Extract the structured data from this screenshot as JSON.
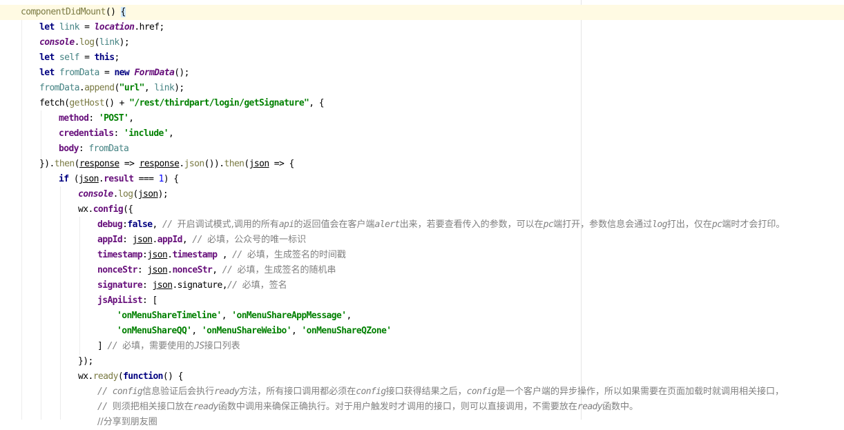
{
  "editor": {
    "lines": [
      {
        "indent": 30,
        "current": true,
        "tokens": [
          {
            "t": "componentDidMount",
            "c": "method"
          },
          {
            "t": "() ",
            "c": ""
          },
          {
            "t": "{",
            "c": "brace-hl"
          }
        ]
      },
      {
        "indent": 57,
        "tokens": [
          {
            "t": "let ",
            "c": "kw"
          },
          {
            "t": "link",
            "c": "local"
          },
          {
            "t": " = ",
            "c": ""
          },
          {
            "t": "location",
            "c": "glob"
          },
          {
            "t": ".href;",
            "c": ""
          }
        ]
      },
      {
        "indent": 57,
        "tokens": [
          {
            "t": "console",
            "c": "glob"
          },
          {
            "t": ".",
            "c": ""
          },
          {
            "t": "log",
            "c": "method"
          },
          {
            "t": "(",
            "c": ""
          },
          {
            "t": "link",
            "c": "local"
          },
          {
            "t": ");",
            "c": ""
          }
        ]
      },
      {
        "indent": 57,
        "tokens": [
          {
            "t": "let ",
            "c": "kw"
          },
          {
            "t": "self",
            "c": "local"
          },
          {
            "t": " = ",
            "c": ""
          },
          {
            "t": "this",
            "c": "kw"
          },
          {
            "t": ";",
            "c": ""
          }
        ]
      },
      {
        "indent": 57,
        "tokens": [
          {
            "t": "let ",
            "c": "kw"
          },
          {
            "t": "fromData",
            "c": "local"
          },
          {
            "t": " = ",
            "c": ""
          },
          {
            "t": "new ",
            "c": "kw"
          },
          {
            "t": "FormData",
            "c": "glob"
          },
          {
            "t": "();",
            "c": ""
          }
        ]
      },
      {
        "indent": 57,
        "tokens": [
          {
            "t": "fromData",
            "c": "local"
          },
          {
            "t": ".",
            "c": ""
          },
          {
            "t": "append",
            "c": "method"
          },
          {
            "t": "(",
            "c": ""
          },
          {
            "t": "\"url\"",
            "c": "str"
          },
          {
            "t": ", ",
            "c": ""
          },
          {
            "t": "link",
            "c": "local"
          },
          {
            "t": ");",
            "c": ""
          }
        ]
      },
      {
        "indent": 57,
        "tokens": [
          {
            "t": "fetch",
            "c": "fn"
          },
          {
            "t": "(",
            "c": ""
          },
          {
            "t": "getHost",
            "c": "method"
          },
          {
            "t": "() + ",
            "c": ""
          },
          {
            "t": "\"/rest/thirdpart/login/getSignature\"",
            "c": "str"
          },
          {
            "t": ", {",
            "c": ""
          }
        ]
      },
      {
        "indent": 85,
        "tokens": [
          {
            "t": "method",
            "c": "prop"
          },
          {
            "t": ": ",
            "c": ""
          },
          {
            "t": "'POST'",
            "c": "str"
          },
          {
            "t": ",",
            "c": ""
          }
        ]
      },
      {
        "indent": 85,
        "tokens": [
          {
            "t": "credentials",
            "c": "prop"
          },
          {
            "t": ": ",
            "c": ""
          },
          {
            "t": "'include'",
            "c": "str"
          },
          {
            "t": ",",
            "c": ""
          }
        ]
      },
      {
        "indent": 85,
        "tokens": [
          {
            "t": "body",
            "c": "prop"
          },
          {
            "t": ": ",
            "c": ""
          },
          {
            "t": "fromData",
            "c": "local"
          }
        ]
      },
      {
        "indent": 57,
        "tokens": [
          {
            "t": "}).",
            "c": ""
          },
          {
            "t": "then",
            "c": "method"
          },
          {
            "t": "(",
            "c": ""
          },
          {
            "t": "response",
            "c": "param"
          },
          {
            "t": " => ",
            "c": ""
          },
          {
            "t": "response",
            "c": "param"
          },
          {
            "t": ".",
            "c": ""
          },
          {
            "t": "json",
            "c": "method"
          },
          {
            "t": "()).",
            "c": ""
          },
          {
            "t": "then",
            "c": "method"
          },
          {
            "t": "(",
            "c": ""
          },
          {
            "t": "json",
            "c": "param"
          },
          {
            "t": " => {",
            "c": ""
          }
        ]
      },
      {
        "indent": 85,
        "tokens": [
          {
            "t": "if ",
            "c": "kw"
          },
          {
            "t": "(",
            "c": ""
          },
          {
            "t": "json",
            "c": "param"
          },
          {
            "t": ".",
            "c": ""
          },
          {
            "t": "result",
            "c": "prop"
          },
          {
            "t": " === ",
            "c": ""
          },
          {
            "t": "1",
            "c": "num"
          },
          {
            "t": ") {",
            "c": ""
          }
        ]
      },
      {
        "indent": 113,
        "tokens": [
          {
            "t": "console",
            "c": "glob"
          },
          {
            "t": ".",
            "c": ""
          },
          {
            "t": "log",
            "c": "method"
          },
          {
            "t": "(",
            "c": ""
          },
          {
            "t": "json",
            "c": "param"
          },
          {
            "t": ");",
            "c": ""
          }
        ]
      },
      {
        "indent": 113,
        "tokens": [
          {
            "t": "wx",
            "c": ""
          },
          {
            "t": ".",
            "c": ""
          },
          {
            "t": "config",
            "c": "prop"
          },
          {
            "t": "({",
            "c": ""
          }
        ]
      },
      {
        "indent": 141,
        "tokens": [
          {
            "t": "debug",
            "c": "prop"
          },
          {
            "t": ":",
            "c": ""
          },
          {
            "t": "false",
            "c": "kw"
          },
          {
            "t": ", ",
            "c": ""
          },
          {
            "t": "// ",
            "c": "cmt"
          },
          {
            "t": "开启调试模式,调用的所有",
            "c": "cmt-cn"
          },
          {
            "t": "api",
            "c": "cmt"
          },
          {
            "t": "的返回值会在客户端",
            "c": "cmt-cn"
          },
          {
            "t": "alert",
            "c": "cmt"
          },
          {
            "t": "出来，若要查看传入的参数，可以在",
            "c": "cmt-cn"
          },
          {
            "t": "pc",
            "c": "cmt"
          },
          {
            "t": "端打开，参数信息会通过",
            "c": "cmt-cn"
          },
          {
            "t": "log",
            "c": "cmt"
          },
          {
            "t": "打出，仅在",
            "c": "cmt-cn"
          },
          {
            "t": "pc",
            "c": "cmt"
          },
          {
            "t": "端时才会打印。",
            "c": "cmt-cn"
          }
        ]
      },
      {
        "indent": 141,
        "tokens": [
          {
            "t": "appId",
            "c": "prop"
          },
          {
            "t": ": ",
            "c": ""
          },
          {
            "t": "json",
            "c": "param"
          },
          {
            "t": ".",
            "c": ""
          },
          {
            "t": "appId",
            "c": "prop"
          },
          {
            "t": ", ",
            "c": ""
          },
          {
            "t": "// ",
            "c": "cmt"
          },
          {
            "t": "必填，公众号的唯一标识",
            "c": "cmt-cn"
          }
        ]
      },
      {
        "indent": 141,
        "tokens": [
          {
            "t": "timestamp",
            "c": "prop"
          },
          {
            "t": ":",
            "c": ""
          },
          {
            "t": "json",
            "c": "param"
          },
          {
            "t": ".",
            "c": ""
          },
          {
            "t": "timestamp",
            "c": "prop"
          },
          {
            "t": " , ",
            "c": ""
          },
          {
            "t": "// ",
            "c": "cmt"
          },
          {
            "t": "必填，生成签名的时间戳",
            "c": "cmt-cn"
          }
        ]
      },
      {
        "indent": 141,
        "tokens": [
          {
            "t": "nonceStr",
            "c": "prop"
          },
          {
            "t": ": ",
            "c": ""
          },
          {
            "t": "json",
            "c": "param"
          },
          {
            "t": ".",
            "c": ""
          },
          {
            "t": "nonceStr",
            "c": "prop"
          },
          {
            "t": ", ",
            "c": ""
          },
          {
            "t": "// ",
            "c": "cmt"
          },
          {
            "t": "必填，生成签名的随机串",
            "c": "cmt-cn"
          }
        ]
      },
      {
        "indent": 141,
        "tokens": [
          {
            "t": "signature",
            "c": "prop"
          },
          {
            "t": ": ",
            "c": ""
          },
          {
            "t": "json",
            "c": "param"
          },
          {
            "t": ".signature,",
            "c": ""
          },
          {
            "t": "// ",
            "c": "cmt"
          },
          {
            "t": "必填，签名",
            "c": "cmt-cn"
          }
        ]
      },
      {
        "indent": 141,
        "tokens": [
          {
            "t": "jsApiList",
            "c": "prop"
          },
          {
            "t": ": [",
            "c": ""
          }
        ]
      },
      {
        "indent": 169,
        "tokens": [
          {
            "t": "'onMenuShareTimeline'",
            "c": "str"
          },
          {
            "t": ", ",
            "c": ""
          },
          {
            "t": "'onMenuShareAppMessage'",
            "c": "str"
          },
          {
            "t": ",",
            "c": ""
          }
        ]
      },
      {
        "indent": 169,
        "tokens": [
          {
            "t": "'onMenuShareQQ'",
            "c": "str"
          },
          {
            "t": ", ",
            "c": ""
          },
          {
            "t": "'onMenuShareWeibo'",
            "c": "str"
          },
          {
            "t": ", ",
            "c": ""
          },
          {
            "t": "'onMenuShareQZone'",
            "c": "str"
          }
        ]
      },
      {
        "indent": 141,
        "tokens": [
          {
            "t": "] ",
            "c": ""
          },
          {
            "t": "// ",
            "c": "cmt"
          },
          {
            "t": "必填，需要使用的",
            "c": "cmt-cn"
          },
          {
            "t": "JS",
            "c": "cmt"
          },
          {
            "t": "接口列表",
            "c": "cmt-cn"
          }
        ]
      },
      {
        "indent": 113,
        "tokens": [
          {
            "t": "});",
            "c": ""
          }
        ]
      },
      {
        "indent": 113,
        "tokens": [
          {
            "t": "wx",
            "c": ""
          },
          {
            "t": ".",
            "c": ""
          },
          {
            "t": "ready",
            "c": "method"
          },
          {
            "t": "(",
            "c": ""
          },
          {
            "t": "function",
            "c": "kw"
          },
          {
            "t": "() {",
            "c": ""
          }
        ]
      },
      {
        "indent": 141,
        "tokens": [
          {
            "t": "// ",
            "c": "cmt"
          },
          {
            "t": "config",
            "c": "cmt"
          },
          {
            "t": "信息验证后会执行",
            "c": "cmt-cn"
          },
          {
            "t": "ready",
            "c": "cmt"
          },
          {
            "t": "方法，所有接口调用都必须在",
            "c": "cmt-cn"
          },
          {
            "t": "config",
            "c": "cmt"
          },
          {
            "t": "接口获得结果之后，",
            "c": "cmt-cn"
          },
          {
            "t": "config",
            "c": "cmt"
          },
          {
            "t": "是一个客户端的异步操作，所以如果需要在页面加载时就调用相关接口，",
            "c": "cmt-cn"
          }
        ]
      },
      {
        "indent": 141,
        "tokens": [
          {
            "t": "// ",
            "c": "cmt"
          },
          {
            "t": "则须把相关接口放在",
            "c": "cmt-cn"
          },
          {
            "t": "ready",
            "c": "cmt"
          },
          {
            "t": "函数中调用来确保正确执行。对于用户触发时才调用的接口，则可以直接调用，不需要放在",
            "c": "cmt-cn"
          },
          {
            "t": "ready",
            "c": "cmt"
          },
          {
            "t": "函数中。",
            "c": "cmt-cn"
          }
        ]
      },
      {
        "indent": 141,
        "tokens": [
          {
            "t": "//分享到朋友圈",
            "c": "cmt-cn"
          }
        ]
      }
    ]
  }
}
